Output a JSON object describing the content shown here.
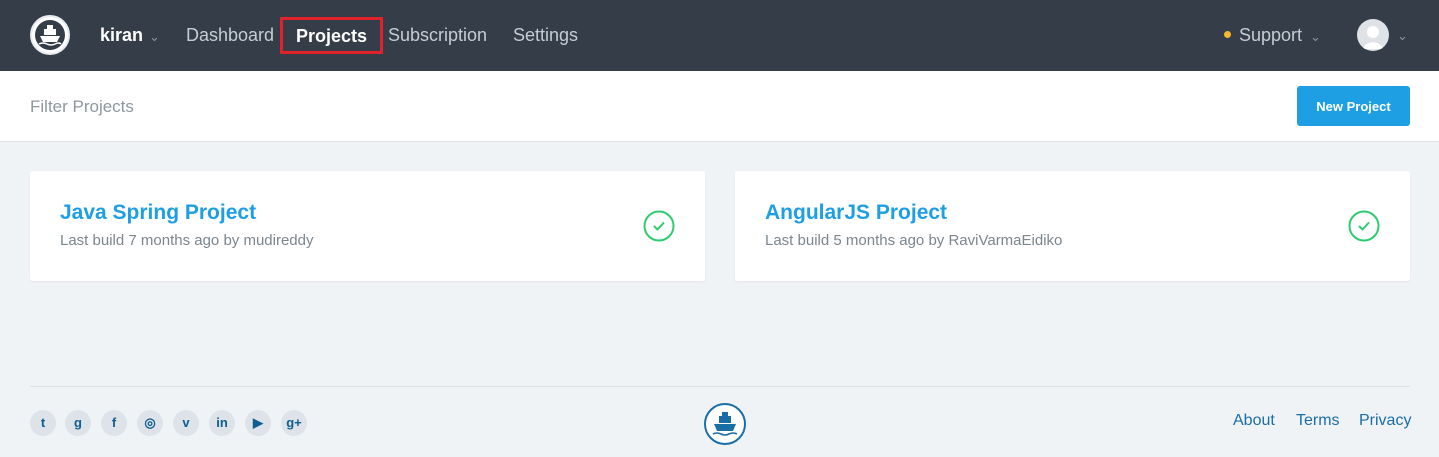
{
  "nav": {
    "user": "kiran",
    "items": [
      "Dashboard",
      "Projects",
      "Subscription",
      "Settings"
    ],
    "active": "Projects",
    "support": "Support"
  },
  "filter": {
    "placeholder": "Filter Projects",
    "value": ""
  },
  "new_project_label": "New Project",
  "projects": [
    {
      "name": "Java Spring Project",
      "meta": "Last build 7 months ago by mudireddy",
      "status": "success"
    },
    {
      "name": "AngularJS Project",
      "meta": "Last build 5 months ago by RaviVarmaEidiko",
      "status": "success"
    }
  ],
  "footer": {
    "social": [
      {
        "icon": "twitter-icon",
        "glyph": "t"
      },
      {
        "icon": "github-icon",
        "glyph": "g"
      },
      {
        "icon": "facebook-icon",
        "glyph": "f"
      },
      {
        "icon": "instagram-icon",
        "glyph": "◎"
      },
      {
        "icon": "vimeo-icon",
        "glyph": "v"
      },
      {
        "icon": "linkedin-icon",
        "glyph": "in"
      },
      {
        "icon": "youtube-icon",
        "glyph": "▶"
      },
      {
        "icon": "googleplus-icon",
        "glyph": "g+"
      }
    ],
    "links": [
      "About",
      "Terms",
      "Privacy"
    ]
  },
  "colors": {
    "topbar": "#343d48",
    "accent": "#1e9fe3",
    "success": "#2ecc71",
    "highlight_box": "#e0222b",
    "support_dot": "#f5b731"
  }
}
